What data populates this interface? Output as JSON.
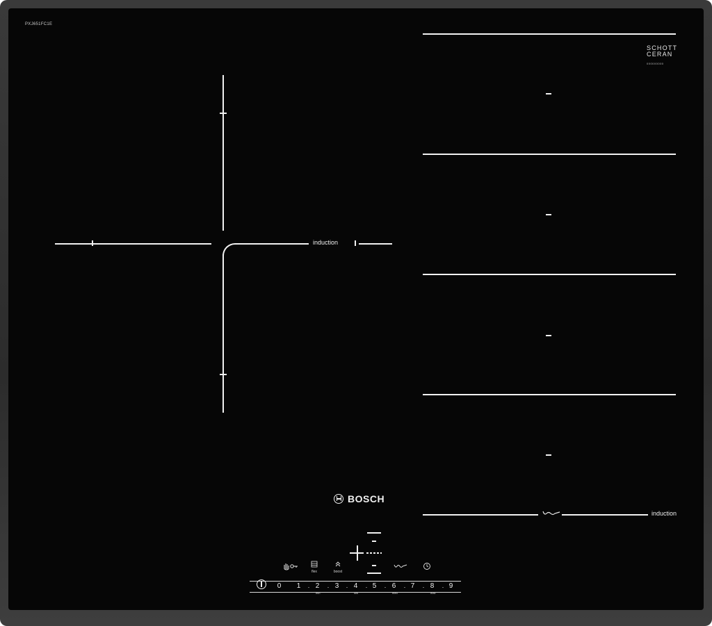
{
  "model": "PXJ651FC1E",
  "glass_brand": {
    "line1": "SCHOTT",
    "line2": "CERAN",
    "sub": "000000000"
  },
  "labels": {
    "induction_left": "induction",
    "induction_right": "induction"
  },
  "brand": "BOSCH",
  "controls": {
    "lock": {
      "icon": "hand-key-icon"
    },
    "flex": {
      "icon": "flex-grid-icon",
      "caption": "flex"
    },
    "boost": {
      "icon": "boost-arrows-icon",
      "caption": "boost"
    },
    "wave": {
      "icon": "wave-icon"
    },
    "timer": {
      "icon": "timer-icon"
    }
  },
  "scale": {
    "numbers": [
      "0",
      "1",
      "2",
      "3",
      "4",
      "5",
      "6",
      "7",
      "8",
      "9"
    ],
    "captions": {
      "min": "min",
      "low": "low",
      "med": "med",
      "max": "max"
    }
  },
  "colors": {
    "glass": "#060606",
    "frame": "#2e2e2e",
    "print": "#f2f2f2"
  }
}
